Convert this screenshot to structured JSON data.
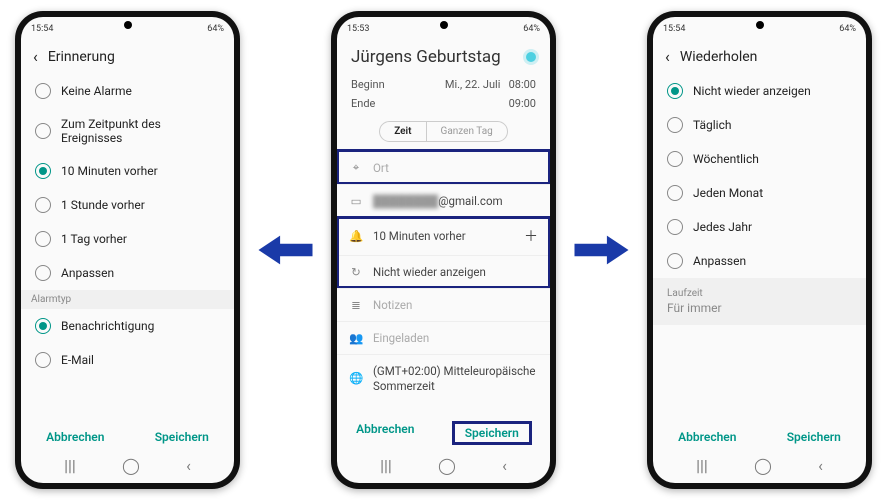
{
  "statusbar": {
    "time1": "15:54",
    "time2": "15:53",
    "time3": "15:54",
    "battery": "64%"
  },
  "phone1": {
    "header": "Erinnerung",
    "options": [
      "Keine Alarme",
      "Zum Zeitpunkt des Ereignisses",
      "10 Minuten vorher",
      "1 Stunde vorher",
      "1 Tag vorher",
      "Anpassen"
    ],
    "selected_index": 2,
    "alarmtyp_label": "Alarmtyp",
    "alarmtyp_options": [
      "Benachrichtigung",
      "E-Mail"
    ],
    "alarmtyp_selected": 0,
    "cancel": "Abbrechen",
    "save": "Speichern"
  },
  "phone2": {
    "title": "Jürgens Geburtstag",
    "begin_label": "Beginn",
    "begin_date": "Mi., 22. Juli",
    "begin_time": "08:00",
    "end_label": "Ende",
    "end_time": "09:00",
    "seg_time": "Zeit",
    "seg_allday": "Ganzen Tag",
    "location_placeholder": "Ort",
    "account_suffix": "@gmail.com",
    "reminder": "10 Minuten vorher",
    "repeat": "Nicht wieder anzeigen",
    "notes": "Notizen",
    "invited": "Eingeladen",
    "timezone": "(GMT+02:00) Mitteleuropäische Sommerzeit",
    "cancel": "Abbrechen",
    "save": "Speichern"
  },
  "phone3": {
    "header": "Wiederholen",
    "options": [
      "Nicht wieder anzeigen",
      "Täglich",
      "Wöchentlich",
      "Jeden Monat",
      "Jedes Jahr",
      "Anpassen"
    ],
    "selected_index": 0,
    "duration_label": "Laufzeit",
    "duration_value": "Für immer",
    "cancel": "Abbrechen",
    "save": "Speichern"
  },
  "arrows": {
    "color": "#1a3aa8"
  }
}
